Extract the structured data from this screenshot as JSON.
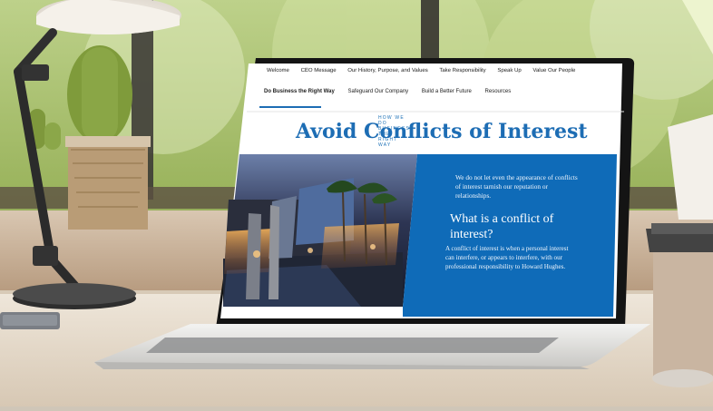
{
  "website": {
    "nav_main": [
      "Welcome",
      "CEO Message",
      "Our History, Purpose, and Values",
      "Take Responsibility",
      "Speak Up",
      "Value Our People"
    ],
    "nav_sub": [
      "Do Business the Right Way",
      "Safeguard Our Company",
      "Build a Better Future",
      "Resources"
    ],
    "eyebrow": "HOW WE DO BUSINESS THE RIGHT WAY",
    "headline": "Avoid Conflicts of Interest",
    "intro_text": "We do not let even the appearance of conflicts of interest tarnish our reputation or relationships.",
    "section_heading": "What is a conflict of interest?",
    "definition_text": "A conflict of interest is when a personal interest can interfere, or appears to interfere, with our professional responsibility to Howard Hughes."
  },
  "colors": {
    "accent_blue": "#1d6db4",
    "panel_blue": "#0f6bb8",
    "screen_white": "#ffffff",
    "laptop_silver": "#d9d9d6",
    "desk_wood": "#e8dfd0"
  }
}
